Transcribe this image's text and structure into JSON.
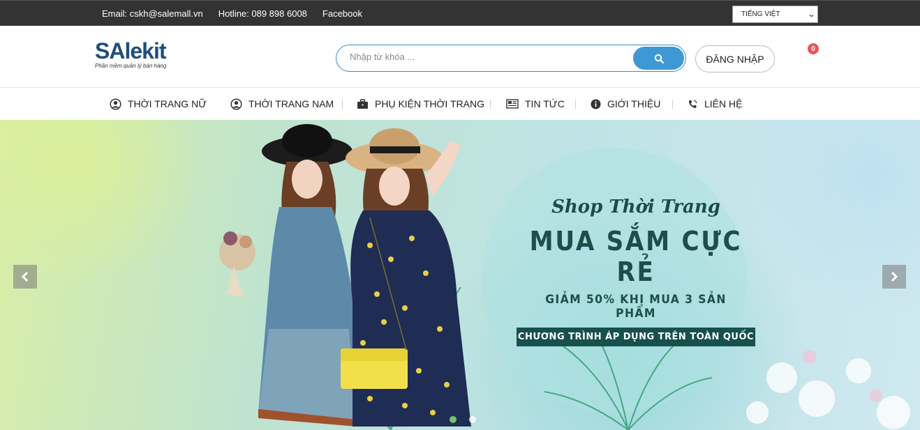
{
  "topbar": {
    "email": "Email: cskh@salemall.vn",
    "hotline": "Hotline: 089 898 6008",
    "facebook": "Facebook",
    "language": "TIẾNG VIỆT"
  },
  "header": {
    "logo": {
      "name": "SAlekit",
      "tagline": "Phần mềm quản lý bán hàng"
    },
    "search_placeholder": "Nhập từ khóa ...",
    "login_label": "ĐĂNG NHẬP",
    "cart_count": "0"
  },
  "nav": {
    "items": [
      {
        "label": "THỜI TRANG NỮ",
        "icon": "user-circle-icon"
      },
      {
        "label": "THỜI TRANG NAM",
        "icon": "user-circle-icon"
      },
      {
        "label": "PHỤ KIỆN THỜI TRANG",
        "icon": "briefcase-icon"
      },
      {
        "label": "TIN TỨC",
        "icon": "newspaper-icon"
      },
      {
        "label": "GIỚI THIỆU",
        "icon": "info-icon"
      },
      {
        "label": "LIÊN HỆ",
        "icon": "phone-icon"
      }
    ]
  },
  "banner": {
    "subtitle": "Shop Thời Trang",
    "headline": "MUA SẮM CỰC RẺ",
    "offer": "GIẢM 50% KHI MUA 3 SẢN PHẨM",
    "note": "CHƯƠNG TRÌNH ÁP DỤNG TRÊN TOÀN QUỐC",
    "active_slide": 1,
    "slide_count": 2
  },
  "colors": {
    "topbar_bg": "#333333",
    "accent_blue": "#3e98d6",
    "badge_red": "#e8575a",
    "promo_dark": "#17504d"
  }
}
